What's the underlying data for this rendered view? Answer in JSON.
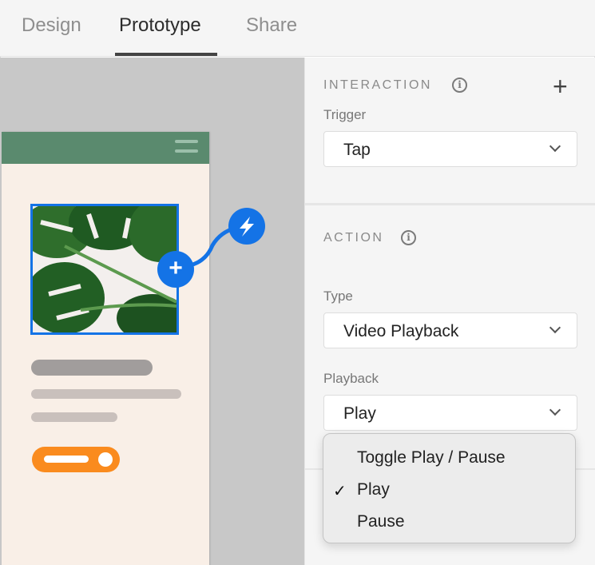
{
  "tabs": [
    {
      "label": "Design"
    },
    {
      "label": "Prototype",
      "active": true
    },
    {
      "label": "Share"
    }
  ],
  "panel": {
    "interaction": {
      "title": "INTERACTION",
      "trigger_label": "Trigger",
      "trigger_value": "Tap"
    },
    "action": {
      "title": "ACTION",
      "type_label": "Type",
      "type_value": "Video Playback",
      "playback_label": "Playback",
      "playback_value": "Play"
    }
  },
  "dropdown": {
    "options": [
      {
        "label": "Toggle Play / Pause",
        "checked": false
      },
      {
        "label": "Play",
        "checked": true
      },
      {
        "label": "Pause",
        "checked": false
      }
    ],
    "check_glyph": "✓"
  },
  "colors": {
    "accent": "#1473e6",
    "artboard_header": "#5a8a6e",
    "cta": "#fa8b1e"
  },
  "icons": {
    "add_interaction": "+",
    "info": "i",
    "connector_plus": "+",
    "trigger": "lightning-bolt-icon"
  }
}
